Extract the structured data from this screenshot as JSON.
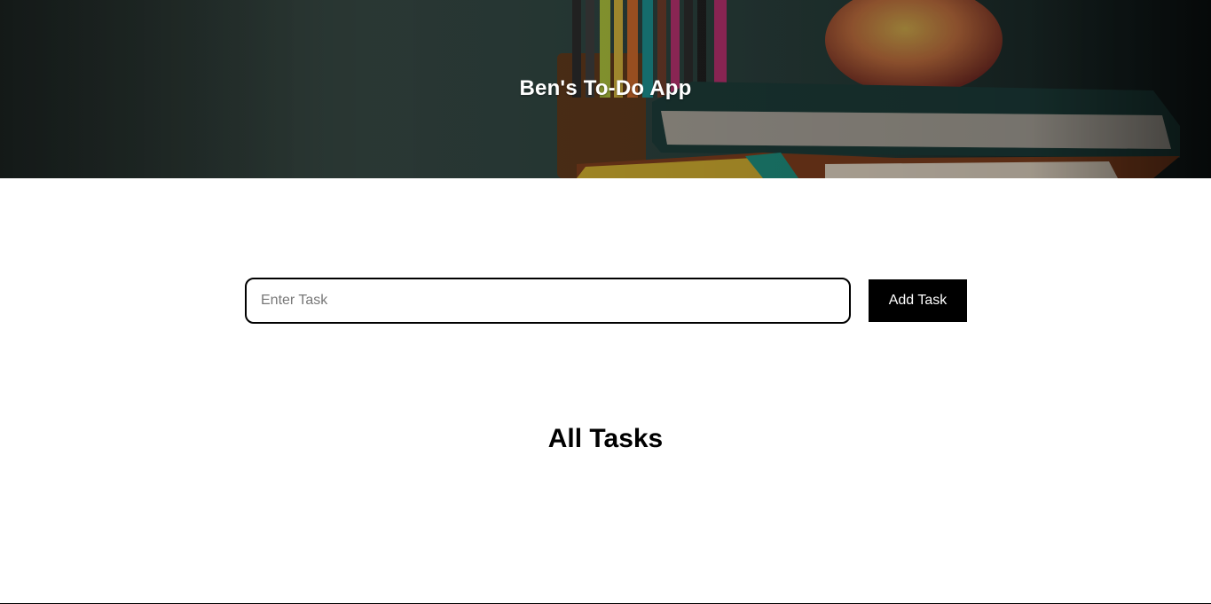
{
  "header": {
    "title": "Ben's To-Do App",
    "background_image": "classroom-books-pencils-apple"
  },
  "task_form": {
    "input_value": "",
    "input_placeholder": "Enter Task",
    "add_button_label": "Add Task"
  },
  "task_list": {
    "heading": "All Tasks",
    "items": []
  },
  "colors": {
    "button_bg": "#000000",
    "button_text": "#ffffff",
    "header_text": "#ffffff",
    "page_bg": "#ffffff"
  }
}
